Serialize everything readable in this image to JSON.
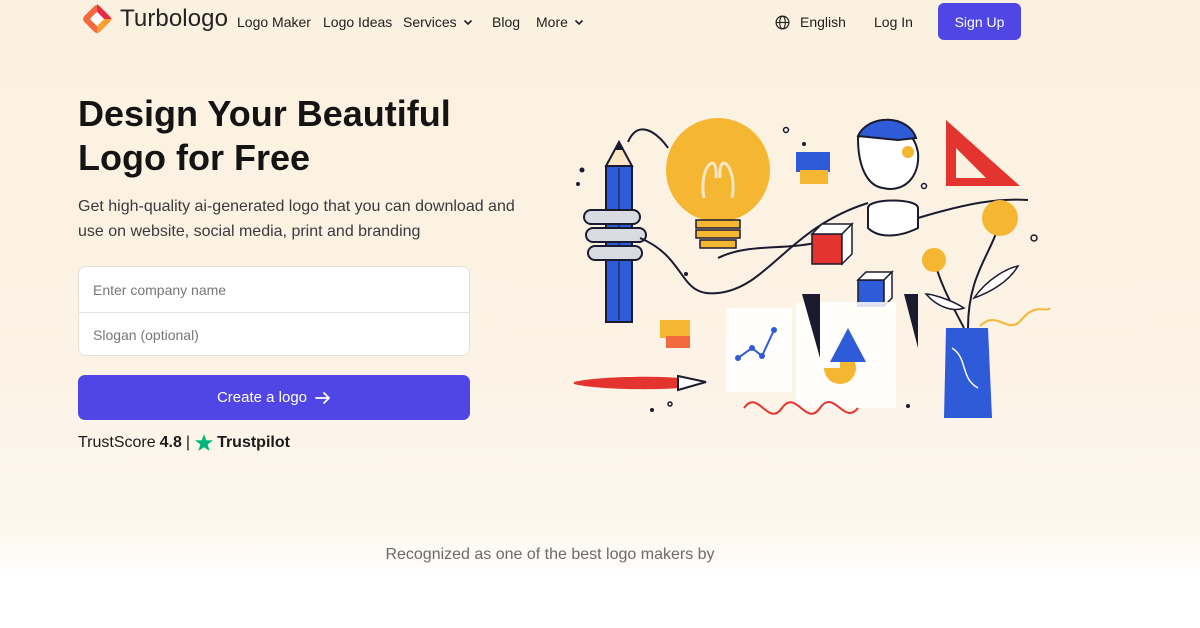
{
  "brand": {
    "name": "Turbologo"
  },
  "nav": {
    "items": [
      {
        "label": "Logo Maker"
      },
      {
        "label": "Logo Ideas"
      },
      {
        "label": "Services"
      },
      {
        "label": "Blog"
      },
      {
        "label": "More"
      }
    ],
    "language": "English",
    "login": "Log In",
    "signup": "Sign Up"
  },
  "hero": {
    "title_line1": "Design Your Beautiful",
    "title_line2": "Logo for Free",
    "subtitle": "Get high-quality ai-generated logo that you can download and use on website, social media, print and branding",
    "company_placeholder": "Enter company name",
    "slogan_placeholder": "Slogan (optional)",
    "cta_label": "Create a logo",
    "trust_prefix": "TrustScore",
    "trust_score": "4.8",
    "trust_divider": "|",
    "trust_brand": "Trustpilot"
  },
  "footer_hint": "Recognized as one of the best logo makers by",
  "colors": {
    "accent": "#5046e5",
    "trustpilot_green": "#00b67a",
    "illustration_yellow": "#f5b731",
    "illustration_blue": "#2f5bd8",
    "illustration_red": "#e3342f"
  }
}
